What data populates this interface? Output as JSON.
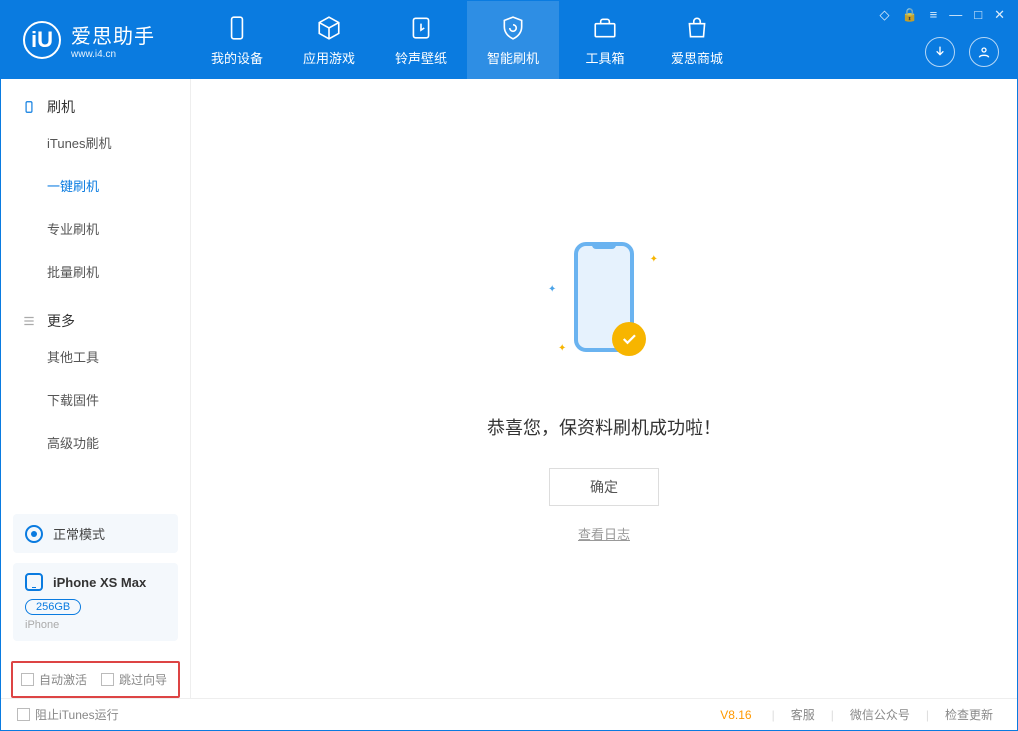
{
  "app": {
    "title": "爱思助手",
    "subtitle": "www.i4.cn",
    "logo_letter": "iU"
  },
  "nav": {
    "items": [
      {
        "label": "我的设备"
      },
      {
        "label": "应用游戏"
      },
      {
        "label": "铃声壁纸"
      },
      {
        "label": "智能刷机"
      },
      {
        "label": "工具箱"
      },
      {
        "label": "爱思商城"
      }
    ]
  },
  "sidebar": {
    "section1": {
      "title": "刷机",
      "items": [
        {
          "label": "iTunes刷机"
        },
        {
          "label": "一键刷机"
        },
        {
          "label": "专业刷机"
        },
        {
          "label": "批量刷机"
        }
      ]
    },
    "section2": {
      "title": "更多",
      "items": [
        {
          "label": "其他工具"
        },
        {
          "label": "下载固件"
        },
        {
          "label": "高级功能"
        }
      ]
    },
    "mode": {
      "label": "正常模式"
    },
    "device": {
      "name": "iPhone XS Max",
      "storage": "256GB",
      "type": "iPhone"
    },
    "options": {
      "opt1": "自动激活",
      "opt2": "跳过向导"
    }
  },
  "main": {
    "success_text": "恭喜您，保资料刷机成功啦！",
    "ok_button": "确定",
    "view_log": "查看日志"
  },
  "footer": {
    "block_itunes": "阻止iTunes运行",
    "version": "V8.16",
    "links": {
      "service": "客服",
      "wechat": "微信公众号",
      "update": "检查更新"
    }
  }
}
